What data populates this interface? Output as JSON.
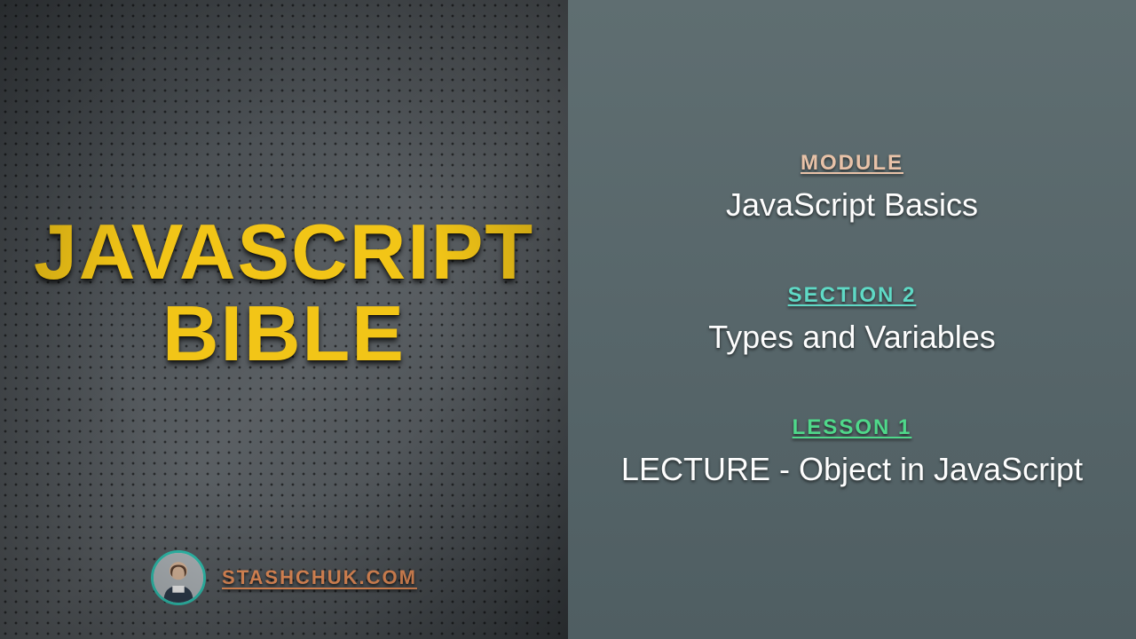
{
  "left": {
    "title_line1": "JAVASCRIPT",
    "title_line2": "BIBLE",
    "site": "STASHCHUK.COM"
  },
  "right": {
    "module": {
      "label": "MODULE",
      "value": "JavaScript Basics"
    },
    "section": {
      "label": "SECTION 2",
      "value": "Types and Variables"
    },
    "lesson": {
      "label": "LESSON 1",
      "value": "LECTURE - Object in JavaScript"
    }
  },
  "colors": {
    "title": "#f2c517",
    "site": "#e28b57",
    "module_label": "#e8c2a8",
    "section_label": "#5fd9c5",
    "lesson_label": "#4fd88a",
    "value_text": "#fdfdfd",
    "avatar_ring": "#2fbfae"
  }
}
